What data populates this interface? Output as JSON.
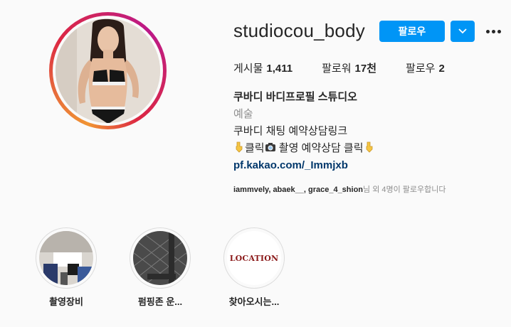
{
  "profile": {
    "username": "studiocou_body",
    "follow_label": "팔로우",
    "more_label": "..."
  },
  "stats": [
    {
      "label": "게시물",
      "value": "1,411"
    },
    {
      "label": "팔로워",
      "value": "17천"
    },
    {
      "label": "팔로우",
      "value": "2"
    }
  ],
  "bio": {
    "name": "쿠바디 바디프로필 스튜디오",
    "category": "예술",
    "line1": "쿠바디 채팅 예약상담링크",
    "line2_a": "클릭",
    "line2_b": " 촬영 예약상담 클릭",
    "link": "pf.kakao.com/_Immjxb"
  },
  "followed_by": {
    "users": "iammvely, abaek__, grace_4_shion",
    "suffix": "님 외 4명이 팔로우합니다"
  },
  "highlights": [
    {
      "label": "촬영장비"
    },
    {
      "label": "펌핑존 운..."
    },
    {
      "label": "찾아오시는...",
      "cover_text": "LOCATION"
    }
  ],
  "colors": {
    "accent": "#0095f6",
    "link": "#00376b",
    "muted": "#8e8e8e",
    "location_text": "#8b1a1a"
  }
}
